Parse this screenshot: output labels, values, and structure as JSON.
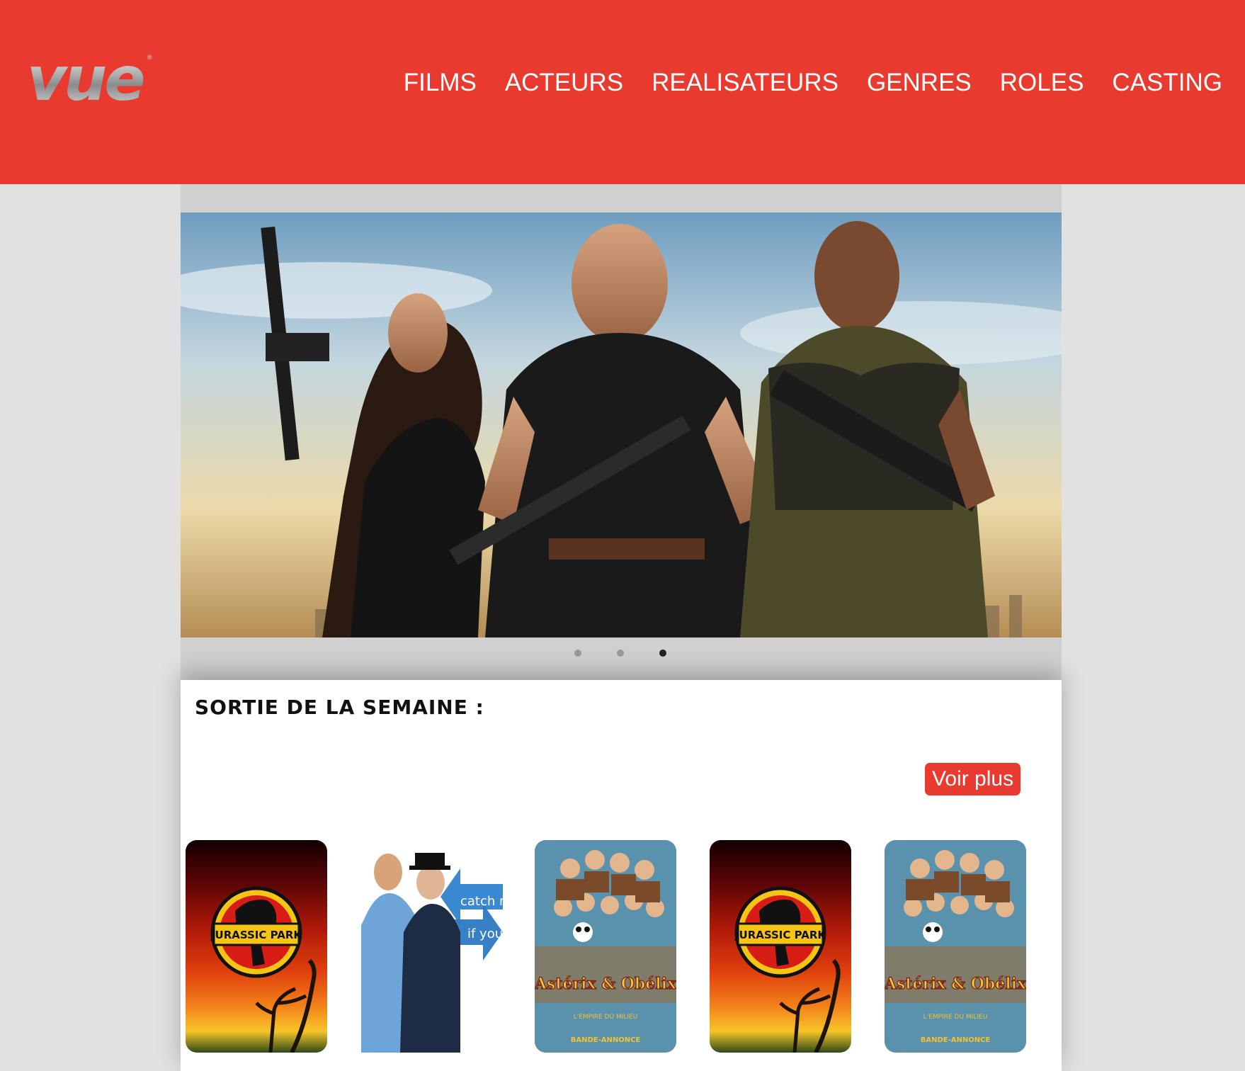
{
  "brand": {
    "logo_text": "vue",
    "registered_mark": "®",
    "primary_color": "#e83a2f"
  },
  "nav": {
    "items": [
      {
        "label": "FILMS"
      },
      {
        "label": "ACTEURS"
      },
      {
        "label": "REALISATEURS"
      },
      {
        "label": "GENRES"
      },
      {
        "label": "ROLES"
      },
      {
        "label": "CASTING"
      }
    ]
  },
  "carousel": {
    "slide_count": 3,
    "active_index": 2,
    "slide_image": "action-movie-poster"
  },
  "releases": {
    "title": "SORTIE DE LA SEMAINE :",
    "see_more_label": "Voir plus",
    "posters": [
      {
        "id": "jurassic-park",
        "logo_text": "JURASSIC PARK"
      },
      {
        "id": "catch-me-if-you-can",
        "line1": "catch me",
        "line2": "if you can"
      },
      {
        "id": "asterix-obelix",
        "title": "Astérix & Obélix",
        "subtitle": "L'EMPIRE DU MILIEU",
        "tag": "BANDE-ANNONCE"
      },
      {
        "id": "jurassic-park-2",
        "logo_text": "JURASSIC PARK"
      },
      {
        "id": "asterix-obelix-2",
        "title": "Astérix & Obélix",
        "subtitle": "L'EMPIRE DU MILIEU",
        "tag": "BANDE-ANNONCE"
      }
    ]
  }
}
